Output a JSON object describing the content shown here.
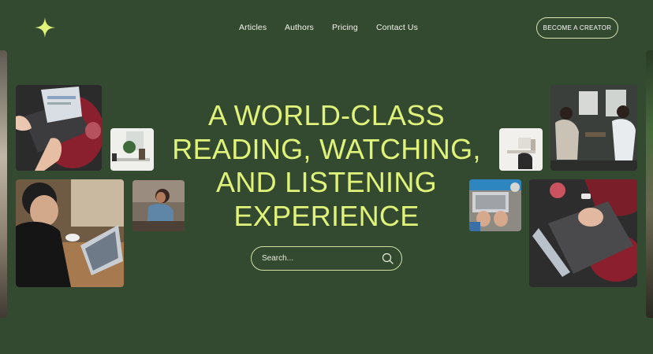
{
  "brand": {
    "logo_icon": "sparkle-star-icon",
    "accent_color": "#dff27a"
  },
  "nav": {
    "links": [
      "Articles",
      "Authors",
      "Pricing",
      "Contact Us"
    ]
  },
  "cta": {
    "label": "BECOME A CREATOR"
  },
  "hero": {
    "lines": [
      "A WORLD-CLASS",
      "READING, WATCHING,",
      "AND LISTENING",
      "EXPERIENCE"
    ]
  },
  "search": {
    "placeholder": "Search...",
    "icon": "search-icon"
  },
  "colors": {
    "background": "#344a30",
    "headline": "#dff27a",
    "border": "#cfe1a8"
  }
}
